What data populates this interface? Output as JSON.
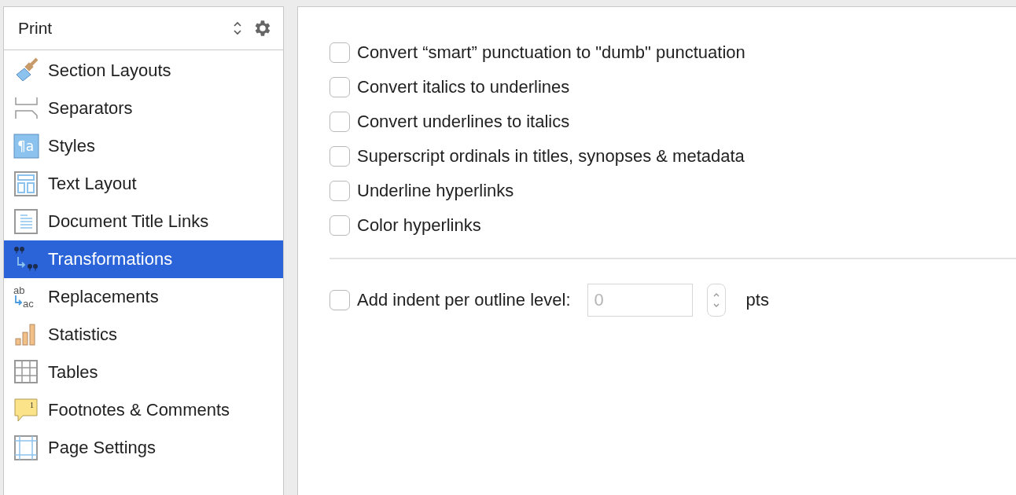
{
  "sidebar": {
    "format_selector": "Print",
    "items": [
      {
        "label": "Section Layouts",
        "selected": false
      },
      {
        "label": "Separators",
        "selected": false
      },
      {
        "label": "Styles",
        "selected": false,
        "icon_text": [
          "¶a"
        ]
      },
      {
        "label": "Text Layout",
        "selected": false
      },
      {
        "label": "Document Title Links",
        "selected": false
      },
      {
        "label": "Transformations",
        "selected": true
      },
      {
        "label": "Replacements",
        "selected": false,
        "icon_text": [
          "ab",
          "ac"
        ]
      },
      {
        "label": "Statistics",
        "selected": false
      },
      {
        "label": "Tables",
        "selected": false
      },
      {
        "label": "Footnotes & Comments",
        "selected": false,
        "icon_text": [
          "1"
        ]
      },
      {
        "label": "Page Settings",
        "selected": false
      }
    ]
  },
  "options": [
    {
      "label": "Convert “smart” punctuation to \"dumb\" punctuation",
      "checked": false
    },
    {
      "label": "Convert italics to underlines",
      "checked": false
    },
    {
      "label": "Convert underlines to italics",
      "checked": false
    },
    {
      "label": "Superscript ordinals in titles, synopses & metadata",
      "checked": false
    },
    {
      "label": "Underline hyperlinks",
      "checked": false
    },
    {
      "label": "Color hyperlinks",
      "checked": false
    }
  ],
  "indent": {
    "label": "Add indent per outline level:",
    "checked": false,
    "value": "0",
    "disabled": true,
    "unit": "pts"
  }
}
